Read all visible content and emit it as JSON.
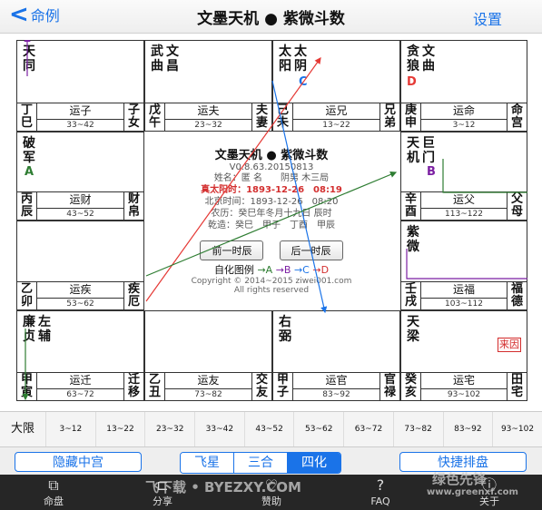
{
  "nav": {
    "back_label": "命例",
    "title": "文墨天机 ● 紫微斗数",
    "settings_label": "设置"
  },
  "chart": {
    "palaces": [
      {
        "stars": [
          "天",
          "同"
        ],
        "star2": [],
        "ganzhi": "丁巳",
        "yun": "运子",
        "age": "33~42",
        "palace": "子女"
      },
      {
        "stars": [
          "武",
          "曲"
        ],
        "star2": [
          "文",
          "昌"
        ],
        "ganzhi": "戊午",
        "yun": "运夫",
        "age": "23~32",
        "palace": "夫妻"
      },
      {
        "stars": [
          "太",
          "阳"
        ],
        "star2": [
          "太",
          "阴"
        ],
        "ganzhi": "己未",
        "yun": "运兄",
        "age": "13~22",
        "palace": "兄弟",
        "mark": "C"
      },
      {
        "stars": [
          "贪",
          "狼"
        ],
        "star2": [
          "文",
          "曲"
        ],
        "ganzhi": "庚申",
        "yun": "运命",
        "age": "3~12",
        "palace": "命宫",
        "mark": "D"
      },
      {
        "stars": [
          "破",
          "军"
        ],
        "star2": [],
        "ganzhi": "丙辰",
        "yun": "运财",
        "age": "43~52",
        "palace": "财帛",
        "mark": "A"
      },
      {
        "stars": [
          "天",
          "机"
        ],
        "star2": [
          "巨",
          "门"
        ],
        "ganzhi": "辛酉",
        "yun": "运父",
        "age": "113~122",
        "palace": "父母",
        "mark": "B"
      },
      {
        "stars": [],
        "star2": [],
        "ganzhi": "乙卯",
        "yun": "运疾",
        "age": "53~62",
        "palace": "疾厄"
      },
      {
        "stars": [
          "紫",
          "微"
        ],
        "star2": [],
        "ganzhi": "壬戌",
        "yun": "运福",
        "age": "103~112",
        "palace": "福德"
      },
      {
        "stars": [
          "廉",
          "贞"
        ],
        "star2": [
          "左",
          "辅"
        ],
        "ganzhi": "甲寅",
        "yun": "运迁",
        "age": "63~72",
        "palace": "迁移"
      },
      {
        "stars": [],
        "star2": [],
        "ganzhi": "乙丑",
        "yun": "运友",
        "age": "73~82",
        "palace": "交友"
      },
      {
        "stars": [
          "右",
          "弼"
        ],
        "star2": [],
        "ganzhi": "甲子",
        "yun": "运官",
        "age": "83~92",
        "palace": "官禄"
      },
      {
        "stars": [
          "天",
          "梁"
        ],
        "star2": [],
        "ganzhi": "癸亥",
        "yun": "运宅",
        "age": "93~102",
        "palace": "田宅",
        "badge": "来因"
      }
    ],
    "center": {
      "title": "文墨天机 ● 紫微斗数",
      "version": "V0.8.63.20150813",
      "name_line": "姓名：匿 名　　阴男 木三局",
      "true_solar": "真太阳时：1893-12-26　08:19",
      "beijing": "北京时间：1893-12-26　08:20",
      "lunar": "农历：癸巳年冬月十九日 辰时",
      "bazi": "乾造：癸巳　甲子　丁酉　甲辰",
      "prev_btn": "前一时辰",
      "next_btn": "后一时辰",
      "legend_label": "自化图例",
      "legend_a": "→A",
      "legend_b": "→B",
      "legend_c": "→C",
      "legend_d": "→D",
      "copyright": "Copyright © 2014~2015 ziwei001.com",
      "rights": "All rights reserved"
    }
  },
  "daxian": {
    "label": "大限",
    "items": [
      "3~12",
      "13~22",
      "23~32",
      "33~42",
      "43~52",
      "53~62",
      "63~72",
      "73~82",
      "83~92",
      "93~102"
    ]
  },
  "controls": {
    "hide_label": "隐藏中宫",
    "seg": [
      "飞星",
      "三合",
      "四化"
    ],
    "seg_active": "四化",
    "quick_label": "快捷排盘"
  },
  "tabs": [
    {
      "label": "命盘",
      "icon": "chart-icon"
    },
    {
      "label": "分享",
      "icon": "share-icon"
    },
    {
      "label": "赞助",
      "icon": "donate-icon"
    },
    {
      "label": "FAQ",
      "icon": "faq-icon"
    },
    {
      "label": "关于",
      "icon": "about-icon"
    }
  ],
  "watermarks": {
    "site1": "飞下载 • BYEZXY.COM",
    "site2": "www.greenxf.com",
    "brand": "绿色先锋"
  },
  "colors": {
    "accent": "#1a73e8",
    "red": "#d32f2f",
    "green": "#2e7d32",
    "purple": "#7b1fa2"
  }
}
